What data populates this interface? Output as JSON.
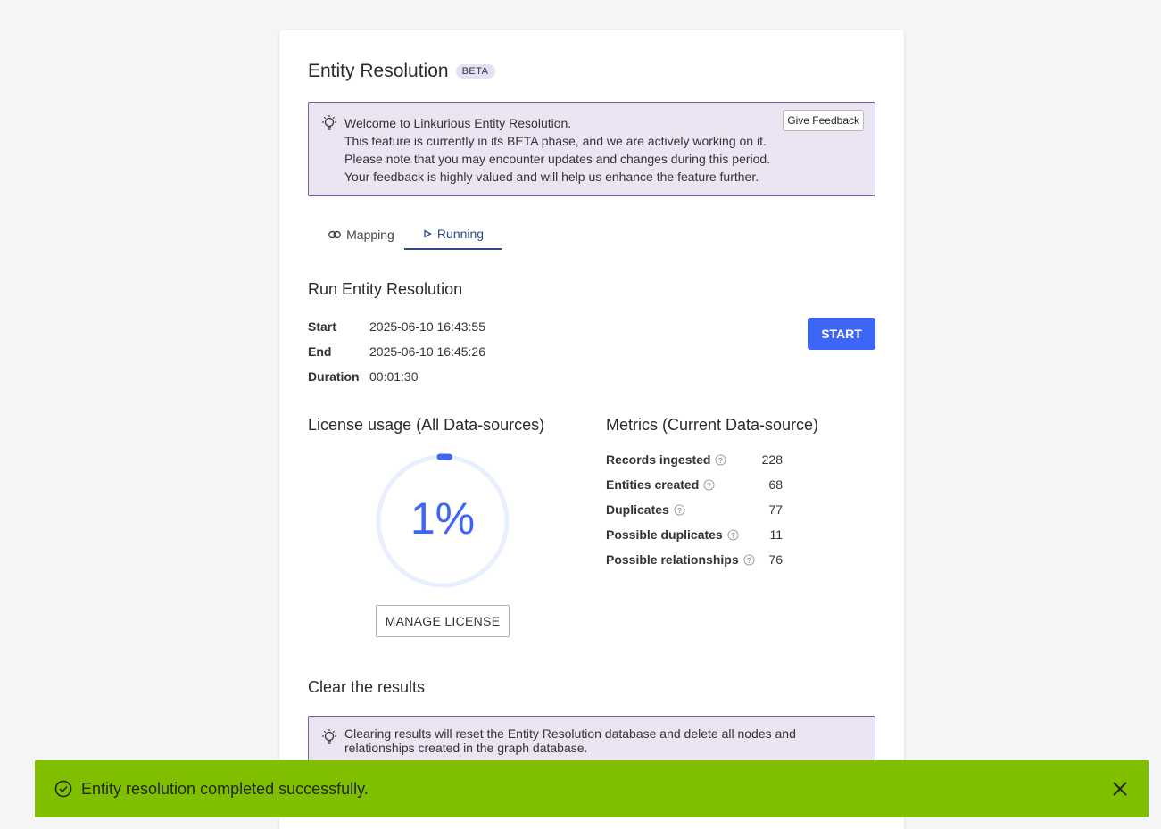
{
  "header": {
    "title": "Entity Resolution",
    "badge": "BETA"
  },
  "welcome_banner": {
    "lines": [
      "Welcome to Linkurious Entity Resolution.",
      "This feature is currently in its BETA phase, and we are actively working on it.",
      "Please note that you may encounter updates and changes during this period.",
      "Your feedback is highly valued and will help us enhance the feature further."
    ],
    "feedback_label": "Give Feedback"
  },
  "tabs": [
    {
      "label": "Mapping",
      "icon": "link-icon"
    },
    {
      "label": "Running",
      "icon": "play-icon",
      "active": true
    }
  ],
  "run": {
    "title": "Run Entity Resolution",
    "rows": [
      {
        "label": "Start",
        "value": "2025-06-10 16:43:55"
      },
      {
        "label": "End",
        "value": "2025-06-10 16:45:26"
      },
      {
        "label": "Duration",
        "value": "00:01:30"
      }
    ],
    "start_label": "START"
  },
  "license": {
    "title": "License usage (All Data-sources)",
    "usage_percent": 1,
    "usage_text": "1%",
    "manage_label": "MANAGE LICENSE"
  },
  "metrics": {
    "title": "Metrics (Current Data-source)",
    "rows": [
      {
        "label": "Records ingested",
        "value": "228"
      },
      {
        "label": "Entities created",
        "value": "68"
      },
      {
        "label": "Duplicates",
        "value": "77"
      },
      {
        "label": "Possible duplicates",
        "value": "11"
      },
      {
        "label": "Possible relationships",
        "value": "76"
      }
    ]
  },
  "clear": {
    "title": "Clear the results",
    "info": "Clearing results will reset the Entity Resolution database and delete all nodes and relationships created in the graph database."
  },
  "toast": {
    "message": "Entity resolution completed successfully."
  },
  "colors": {
    "accent": "#3d66f6",
    "toast_bg": "#7fbf00",
    "info_bg": "#ebe4f3",
    "info_border": "#7a5ca8",
    "tab_active": "#2c4a87"
  }
}
